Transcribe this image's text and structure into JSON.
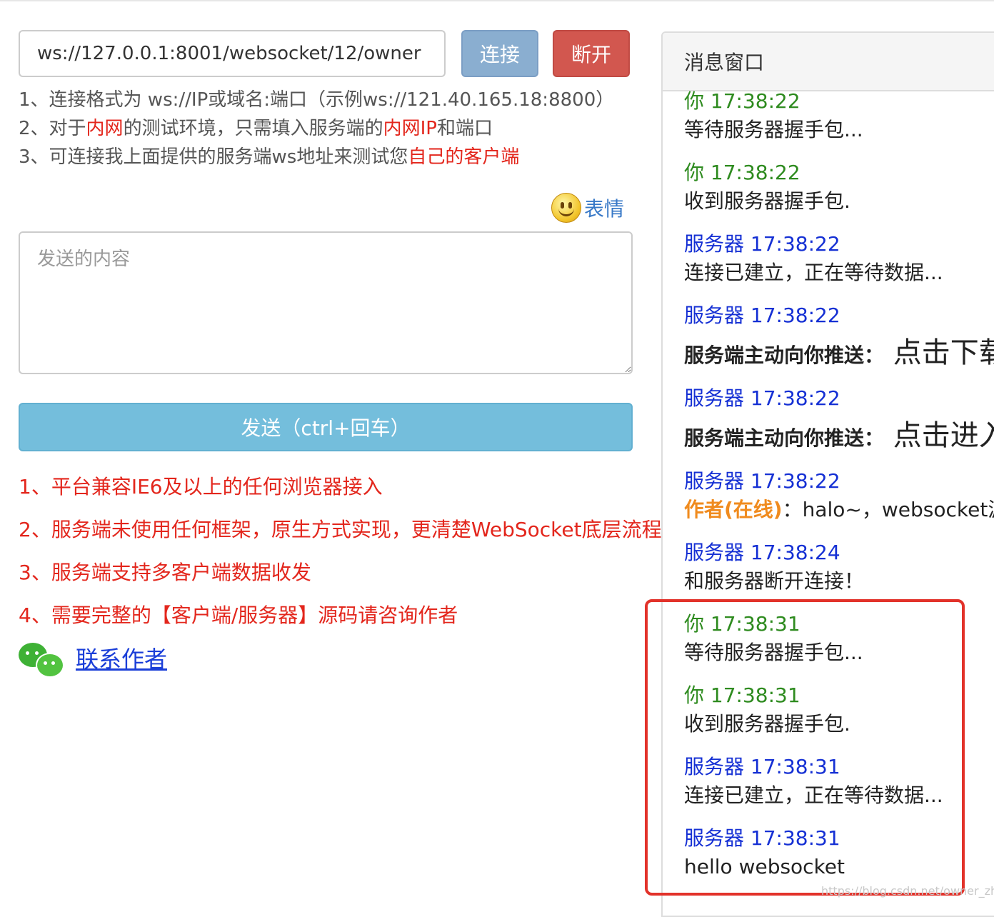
{
  "connection": {
    "url": "ws://127.0.0.1:8001/websocket/12/owner",
    "connect_label": "连接",
    "disconnect_label": "断开"
  },
  "help": [
    {
      "segments": [
        {
          "text": "1、连接格式为 ws://IP或域名:端口（示例ws://121.40.165.18:8800）",
          "red": false
        }
      ]
    },
    {
      "segments": [
        {
          "text": "2、对于",
          "red": false
        },
        {
          "text": "内网",
          "red": true
        },
        {
          "text": "的测试环境，只需填入服务端的",
          "red": false
        },
        {
          "text": "内网IP",
          "red": true
        },
        {
          "text": "和端口",
          "red": false
        }
      ]
    },
    {
      "segments": [
        {
          "text": "3、可连接我上面提供的服务端ws地址来测试您",
          "red": false
        },
        {
          "text": "自己的客户端",
          "red": true
        }
      ]
    }
  ],
  "emoji_label": "表情",
  "send_area": {
    "placeholder": "发送的内容",
    "value": ""
  },
  "send_label": "发送（ctrl+回车）",
  "features": [
    "1、平台兼容IE6及以上的任何浏览器接入",
    "2、服务端未使用任何框架，原生方式实现，更清楚WebSocket底层流程",
    "3、服务端支持多客户端数据收发",
    "4、需要完整的【客户端/服务器】源码请咨询作者"
  ],
  "contact_label": "联系作者",
  "panel": {
    "title": "消息窗口",
    "messages": [
      {
        "sender": "你",
        "role": "you",
        "time": "17:38:22",
        "text": "等待服务器握手包..."
      },
      {
        "sender": "你",
        "role": "you",
        "time": "17:38:22",
        "text": "收到服务器握手包."
      },
      {
        "sender": "服务器",
        "role": "server",
        "time": "17:38:22",
        "text": "连接已建立，正在等待数据..."
      },
      {
        "sender": "服务器",
        "role": "server",
        "time": "17:38:22",
        "push_label": "服务端主动向你推送：",
        "push_text": "点击下载"
      },
      {
        "sender": "服务器",
        "role": "server",
        "time": "17:38:22",
        "push_label": "服务端主动向你推送：",
        "push_text": "点击进入"
      },
      {
        "sender": "服务器",
        "role": "server",
        "time": "17:38:22",
        "author": "作者(在线)",
        "text": "：halo~，websocket源码"
      },
      {
        "sender": "服务器",
        "role": "server",
        "time": "17:38:24",
        "text": "和服务器断开连接！"
      },
      {
        "sender": "你",
        "role": "you",
        "time": "17:38:31",
        "text": "等待服务器握手包..."
      },
      {
        "sender": "你",
        "role": "you",
        "time": "17:38:31",
        "text": "收到服务器握手包."
      },
      {
        "sender": "服务器",
        "role": "server",
        "time": "17:38:31",
        "text": "连接已建立，正在等待数据..."
      },
      {
        "sender": "服务器",
        "role": "server",
        "time": "17:38:31",
        "text": "hello websocket"
      }
    ]
  },
  "watermark": "https://blog.csdn.net/owner_zhou",
  "colors": {
    "you": "#2e8b1f",
    "server": "#1530d4",
    "author": "#f08b1e",
    "red_text": "#e3261c",
    "highlight": "#e2322a"
  },
  "icons": {
    "emoji": "smiley-face-icon",
    "wechat": "wechat-icon"
  }
}
